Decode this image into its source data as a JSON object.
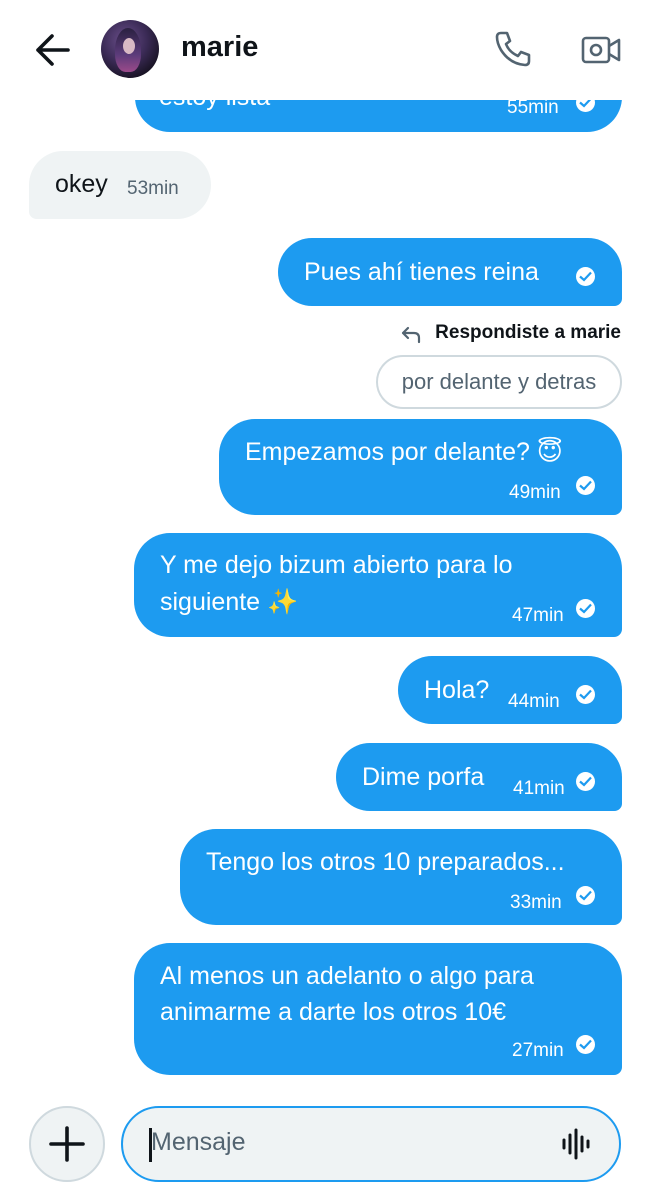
{
  "header": {
    "name": "marie"
  },
  "messages": {
    "cut": {
      "text": "estoy lista",
      "time": "55min"
    },
    "in1": {
      "text": "okey",
      "time": "53min"
    },
    "out1": {
      "text": "Pues ahí tienes reina"
    },
    "reply": {
      "label": "Respondiste a marie",
      "quoted": "por delante y detras"
    },
    "out2": {
      "text": "Empezamos por delante? 😇",
      "time": "49min"
    },
    "out3": {
      "line1": "Y me dejo bizum abierto para lo",
      "line2": "siguiente ✨",
      "time": "47min"
    },
    "out4": {
      "text": "Hola?",
      "time": "44min"
    },
    "out5": {
      "text": "Dime porfa",
      "time": "41min"
    },
    "out6": {
      "text": "Tengo los otros 10 preparados...",
      "time": "33min"
    },
    "out7": {
      "line1": "Al menos un adelanto o algo para",
      "line2": "animarme a darte los otros 10€",
      "time": "27min"
    }
  },
  "composer": {
    "placeholder": "Mensaje"
  },
  "icons": {
    "back": "arrow-left-icon",
    "call": "phone-icon",
    "video": "video-camera-icon",
    "add": "plus-icon",
    "voice": "waveform-icon",
    "read": "check-circle-icon",
    "reply": "reply-arrow-icon"
  },
  "colors": {
    "accent": "#1d9bf0",
    "incoming": "#eff3f4",
    "text": "#0f1419",
    "muted": "#536471"
  }
}
